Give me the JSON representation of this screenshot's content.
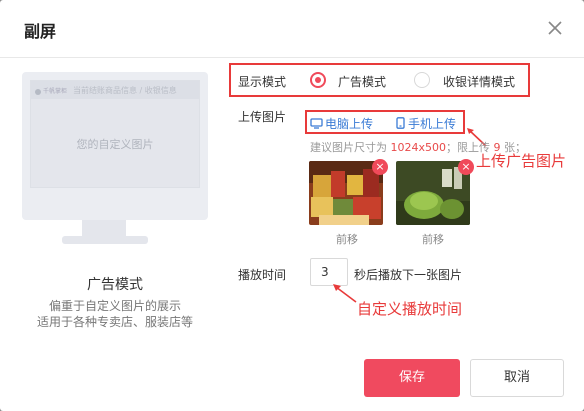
{
  "dialog": {
    "title": "副屏"
  },
  "preview": {
    "screen_logo": "千帆掌柜",
    "screen_info": "当前结账商品信息 / 收银信息",
    "screen_text": "您的自定义图片",
    "mode_title": "广告模式",
    "mode_desc_line1": "偏重于自定义图片的展示",
    "mode_desc_line2": "适用于各种专卖店、服装店等"
  },
  "display_mode": {
    "label": "显示模式",
    "options": [
      {
        "label": "广告模式",
        "selected": true
      },
      {
        "label": "收银详情模式",
        "selected": false
      }
    ]
  },
  "upload": {
    "label": "上传图片",
    "pc_upload": "电脑上传",
    "mobile_upload": "手机上传",
    "tip_prefix": "建议图片尺寸为",
    "tip_size": "1024x500",
    "tip_mid": "；限上传",
    "tip_limit": "9",
    "tip_suffix": "张；",
    "annotation": "上传广告图片",
    "images": [
      {
        "name": "snack-assortment",
        "move_label": "前移"
      },
      {
        "name": "green-pastry",
        "move_label": "前移"
      }
    ]
  },
  "playback": {
    "label": "播放时间",
    "value": "3",
    "suffix": "秒后播放下一张图片",
    "annotation": "自定义播放时间"
  },
  "actions": {
    "save": "保存",
    "cancel": "取消"
  },
  "colors": {
    "accent": "#f04a5f",
    "link": "#3a7bd5",
    "annotation": "#e83a3a"
  }
}
